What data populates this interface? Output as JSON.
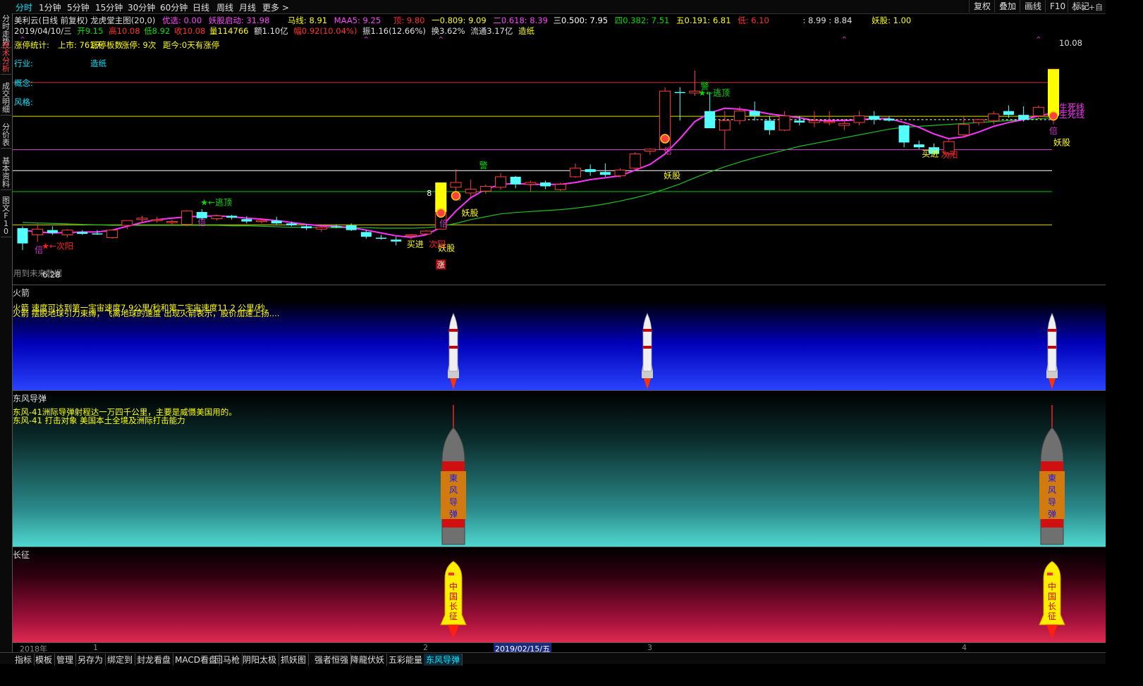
{
  "toolbar": {
    "periods": [
      "分时",
      "1分钟",
      "5分钟",
      "15分钟",
      "30分钟",
      "60分钟",
      "日线",
      "周线",
      "月线",
      "更多 >"
    ],
    "right_buttons": [
      "复权",
      "叠加",
      "画线",
      "F10",
      "标记"
    ],
    "right_icons": "◇ ◇ +自"
  },
  "sidebar": {
    "tabs": [
      "分时走势",
      "技术分析",
      "成交明细",
      "分价表",
      "基本资料",
      "图文F10"
    ]
  },
  "header": {
    "line1": {
      "title": "美利云(日线 前复权) 龙虎堂主图(20,0)",
      "youxuan": "优选: 0.00",
      "yaogu_qidong": "妖股启动: 31.98",
      "maxian": "马线: 8.91",
      "maa5": "MAA5: 9.25",
      "ding": "顶: 9.80",
      "yi": "一0.809: 9.09",
      "er": "二0.618: 8.39",
      "san": "三0.500: 7.95",
      "si": "四0.382: 7.51",
      "wu": "五0.191: 6.81",
      "di": "低: 6.10",
      "extra": ": 8.99 : 8.84",
      "yaogu": "妖股: 1.00"
    },
    "line2": {
      "date": "2019/04/10/三",
      "open": "开9.15",
      "high": "高10.08",
      "low": "低8.92",
      "close": "收10.08",
      "vol": "量114766",
      "amt": "额1.10亿",
      "chg": "幅0.92(10.04%)",
      "amp": "振1.16(12.66%)",
      "turn": "换3.62%",
      "float": "流通3.17亿",
      "sector": "造纸"
    }
  },
  "main_chart": {
    "overlay": {
      "stats_label": "涨停统计:",
      "listing": "上市: 761天",
      "board": "涨停板数",
      "limit_up": "涨停: 9次",
      "since": "距今:0天有涨停",
      "industry_label": "行业:",
      "industry_value": "造纸",
      "concept_label": "概念:",
      "style_label": "风格:",
      "watermark": "用到未来数据"
    },
    "price_top": "10.08",
    "price_bottom": "6.28",
    "labels": {
      "escape_top": "★←逃顶",
      "next_yang": "★←次阳",
      "bei": "倍",
      "yaogu": "妖股",
      "mairu": "买进",
      "ciyang": "次阳",
      "zhang": "涨",
      "sisi": "生死线",
      "jing": "警",
      "eight": "8"
    }
  },
  "panels": {
    "rocket": {
      "title": "火箭",
      "text1": "火箭 速度可达到第一宇宙速度7.9公里/秒和第二宇宙速度11.2 公里/秒",
      "text2": "火箭 摆脱地球引力束缚，飞离地球的速度 出现火箭表示，股价加速上扬....",
      "colors": [
        "#000000",
        "#0000dd",
        "#1a3cff"
      ]
    },
    "missile": {
      "title": "东风导弹",
      "text1": "东风-41洲际导弹射程达一万四千公里，主要是威慑美国用的。",
      "text2": "东风-41 打击对象 美国本土全境及洲际打击能力",
      "missile_label": [
        "東",
        "风",
        "导",
        "弹"
      ]
    },
    "longmarch": {
      "title": "长征",
      "rocket_label": [
        "中",
        "国",
        "长",
        "征"
      ]
    }
  },
  "timeaxis": {
    "year": "2018年",
    "m1": "1",
    "m2": "2",
    "highlight": "2019/02/15/五",
    "m3": "3",
    "m4": "4"
  },
  "bottom_tabs": [
    "指标",
    "模板",
    "管理",
    "另存为",
    "绑定到",
    "封龙看盘",
    "MACD看盘",
    "回马枪",
    "阴阳太极",
    "抓妖图",
    "强者恒强",
    "降龍伏妖",
    "五彩能量",
    "东风导弹"
  ],
  "chart_data": {
    "type": "candlestick",
    "price_range": [
      6.0,
      10.35
    ],
    "candles": [
      {
        "o": 6.74,
        "h": 6.78,
        "l": 6.28,
        "c": 6.42
      },
      {
        "o": 6.6,
        "h": 6.84,
        "l": 6.45,
        "c": 6.72
      },
      {
        "o": 6.7,
        "h": 6.78,
        "l": 6.6,
        "c": 6.64
      },
      {
        "o": 6.6,
        "h": 6.72,
        "l": 6.55,
        "c": 6.7
      },
      {
        "o": 6.66,
        "h": 6.7,
        "l": 6.6,
        "c": 6.62
      },
      {
        "o": 6.63,
        "h": 6.7,
        "l": 6.6,
        "c": 6.62
      },
      {
        "o": 6.54,
        "h": 6.7,
        "l": 6.52,
        "c": 6.7
      },
      {
        "o": 6.8,
        "h": 6.9,
        "l": 6.72,
        "c": 6.9
      },
      {
        "o": 6.92,
        "h": 7.0,
        "l": 6.86,
        "c": 6.95
      },
      {
        "o": 6.9,
        "h": 6.98,
        "l": 6.86,
        "c": 6.92
      },
      {
        "o": 6.86,
        "h": 6.92,
        "l": 6.8,
        "c": 6.88
      },
      {
        "o": 6.82,
        "h": 7.12,
        "l": 6.78,
        "c": 7.1
      },
      {
        "o": 7.08,
        "h": 7.14,
        "l": 6.9,
        "c": 6.95
      },
      {
        "o": 6.94,
        "h": 7.02,
        "l": 6.9,
        "c": 7.0
      },
      {
        "o": 7.0,
        "h": 7.02,
        "l": 6.92,
        "c": 6.96
      },
      {
        "o": 6.93,
        "h": 6.99,
        "l": 6.84,
        "c": 6.88
      },
      {
        "o": 6.88,
        "h": 6.95,
        "l": 6.84,
        "c": 6.9
      },
      {
        "o": 6.9,
        "h": 6.98,
        "l": 6.82,
        "c": 6.84
      },
      {
        "o": 6.84,
        "h": 6.88,
        "l": 6.78,
        "c": 6.8
      },
      {
        "o": 6.78,
        "h": 6.82,
        "l": 6.7,
        "c": 6.74
      },
      {
        "o": 6.72,
        "h": 6.78,
        "l": 6.66,
        "c": 6.76
      },
      {
        "o": 6.78,
        "h": 6.82,
        "l": 6.74,
        "c": 6.76
      },
      {
        "o": 6.8,
        "h": 6.84,
        "l": 6.68,
        "c": 6.7
      },
      {
        "o": 6.66,
        "h": 6.7,
        "l": 6.52,
        "c": 6.56
      },
      {
        "o": 6.54,
        "h": 6.6,
        "l": 6.5,
        "c": 6.52
      },
      {
        "o": 6.5,
        "h": 6.56,
        "l": 6.38,
        "c": 6.46
      },
      {
        "o": 6.58,
        "h": 6.62,
        "l": 6.5,
        "c": 6.6
      },
      {
        "o": 6.62,
        "h": 6.7,
        "l": 6.6,
        "c": 6.68
      },
      {
        "o": 6.72,
        "h": 7.28,
        "l": 6.72,
        "c": 7.28
      },
      {
        "o": 7.6,
        "h": 7.98,
        "l": 7.44,
        "c": 7.7
      },
      {
        "o": 7.48,
        "h": 7.76,
        "l": 7.4,
        "c": 7.56
      },
      {
        "o": 7.52,
        "h": 7.66,
        "l": 7.46,
        "c": 7.62
      },
      {
        "o": 7.6,
        "h": 7.9,
        "l": 7.55,
        "c": 7.82
      },
      {
        "o": 7.82,
        "h": 7.84,
        "l": 7.58,
        "c": 7.66
      },
      {
        "o": 7.66,
        "h": 7.74,
        "l": 7.5,
        "c": 7.7
      },
      {
        "o": 7.7,
        "h": 7.74,
        "l": 7.56,
        "c": 7.62
      },
      {
        "o": 7.55,
        "h": 7.7,
        "l": 7.52,
        "c": 7.66
      },
      {
        "o": 7.82,
        "h": 8.1,
        "l": 7.8,
        "c": 8.0
      },
      {
        "o": 7.98,
        "h": 8.08,
        "l": 7.84,
        "c": 7.92
      },
      {
        "o": 7.92,
        "h": 8.1,
        "l": 7.82,
        "c": 7.86
      },
      {
        "o": 7.84,
        "h": 8.0,
        "l": 7.8,
        "c": 7.96
      },
      {
        "o": 8.0,
        "h": 8.34,
        "l": 7.96,
        "c": 8.3
      },
      {
        "o": 8.36,
        "h": 8.42,
        "l": 8.28,
        "c": 8.4
      },
      {
        "o": 8.4,
        "h": 9.7,
        "l": 8.36,
        "c": 9.62
      },
      {
        "o": 9.6,
        "h": 9.7,
        "l": 9.0,
        "c": 9.58
      },
      {
        "o": 9.58,
        "h": 10.05,
        "l": 9.52,
        "c": 9.62
      },
      {
        "o": 9.2,
        "h": 9.6,
        "l": 9.1,
        "c": 8.84
      },
      {
        "o": 8.8,
        "h": 9.2,
        "l": 8.4,
        "c": 9.0
      },
      {
        "o": 9.0,
        "h": 9.3,
        "l": 8.92,
        "c": 9.2
      },
      {
        "o": 9.2,
        "h": 9.4,
        "l": 9.0,
        "c": 9.1
      },
      {
        "o": 9.0,
        "h": 9.1,
        "l": 8.7,
        "c": 8.8
      },
      {
        "o": 8.8,
        "h": 9.2,
        "l": 8.78,
        "c": 9.1
      },
      {
        "o": 9.0,
        "h": 9.1,
        "l": 8.9,
        "c": 8.96
      },
      {
        "o": 8.96,
        "h": 9.2,
        "l": 8.86,
        "c": 9.0
      },
      {
        "o": 8.96,
        "h": 9.2,
        "l": 8.9,
        "c": 8.98
      },
      {
        "o": 8.9,
        "h": 9.04,
        "l": 8.8,
        "c": 8.94
      },
      {
        "o": 8.96,
        "h": 9.2,
        "l": 8.9,
        "c": 9.1
      },
      {
        "o": 9.1,
        "h": 9.2,
        "l": 8.92,
        "c": 9.02
      },
      {
        "o": 9.04,
        "h": 9.1,
        "l": 8.98,
        "c": 9.0
      },
      {
        "o": 8.9,
        "h": 8.92,
        "l": 8.44,
        "c": 8.54
      },
      {
        "o": 8.5,
        "h": 8.58,
        "l": 8.4,
        "c": 8.44
      },
      {
        "o": 8.44,
        "h": 8.52,
        "l": 8.28,
        "c": 8.3
      },
      {
        "o": 8.3,
        "h": 8.6,
        "l": 8.24,
        "c": 8.56
      },
      {
        "o": 8.7,
        "h": 9.08,
        "l": 8.64,
        "c": 8.92
      },
      {
        "o": 8.96,
        "h": 9.04,
        "l": 8.9,
        "c": 9.02
      },
      {
        "o": 9.0,
        "h": 9.2,
        "l": 8.92,
        "c": 9.14
      },
      {
        "o": 9.2,
        "h": 9.32,
        "l": 9.06,
        "c": 9.12
      },
      {
        "o": 9.12,
        "h": 9.3,
        "l": 8.98,
        "c": 9.02
      },
      {
        "o": 9.1,
        "h": 9.32,
        "l": 9.04,
        "c": 9.28
      },
      {
        "o": 9.15,
        "h": 10.08,
        "l": 8.92,
        "c": 10.08
      }
    ],
    "ma_magenta": [
      6.7,
      6.66,
      6.64,
      6.65,
      6.66,
      6.66,
      6.7,
      6.78,
      6.86,
      6.92,
      6.95,
      6.98,
      6.99,
      7.0,
      6.98,
      6.95,
      6.93,
      6.9,
      6.86,
      6.82,
      6.79,
      6.78,
      6.75,
      6.7,
      6.64,
      6.58,
      6.55,
      6.6,
      6.76,
      7.1,
      7.38,
      7.56,
      7.66,
      7.68,
      7.66,
      7.66,
      7.66,
      7.7,
      7.76,
      7.8,
      7.84,
      7.96,
      8.08,
      8.3,
      8.62,
      8.98,
      9.16,
      9.26,
      9.24,
      9.2,
      9.14,
      9.1,
      9.06,
      9.0,
      9.0,
      9.0,
      9.02,
      9.04,
      9.04,
      8.96,
      8.86,
      8.72,
      8.62,
      8.66,
      8.76,
      8.88,
      8.96,
      9.02,
      9.1,
      9.16
    ],
    "ma_green": [
      6.86,
      6.85,
      6.84,
      6.83,
      6.82,
      6.81,
      6.8,
      6.8,
      6.8,
      6.8,
      6.8,
      6.8,
      6.8,
      6.8,
      6.79,
      6.79,
      6.78,
      6.77,
      6.76,
      6.76,
      6.75,
      6.75,
      6.75,
      6.75,
      6.74,
      6.74,
      6.74,
      6.75,
      6.78,
      6.84,
      6.92,
      6.98,
      7.04,
      7.07,
      7.09,
      7.11,
      7.13,
      7.16,
      7.2,
      7.25,
      7.31,
      7.38,
      7.46,
      7.56,
      7.67,
      7.8,
      7.92,
      8.03,
      8.13,
      8.22,
      8.3,
      8.38,
      8.46,
      8.52,
      8.58,
      8.64,
      8.7,
      8.76,
      8.82,
      8.86,
      8.88,
      8.9,
      8.92,
      8.94,
      8.96,
      8.98,
      9.0,
      9.02,
      9.04,
      9.06
    ],
    "levels": [
      {
        "name": "顶",
        "value": 9.8,
        "color": "#cc3333"
      },
      {
        "name": "一0.809",
        "value": 9.09,
        "color": "#e0e000"
      },
      {
        "name": "二0.618",
        "value": 8.39,
        "color": "#cc44cc"
      },
      {
        "name": "三0.500",
        "value": 7.95,
        "color": "#ffffff"
      },
      {
        "name": "四0.382",
        "value": 7.51,
        "color": "#00cc00"
      },
      {
        "name": "五0.191",
        "value": 6.81,
        "color": "#e0e000"
      }
    ]
  }
}
